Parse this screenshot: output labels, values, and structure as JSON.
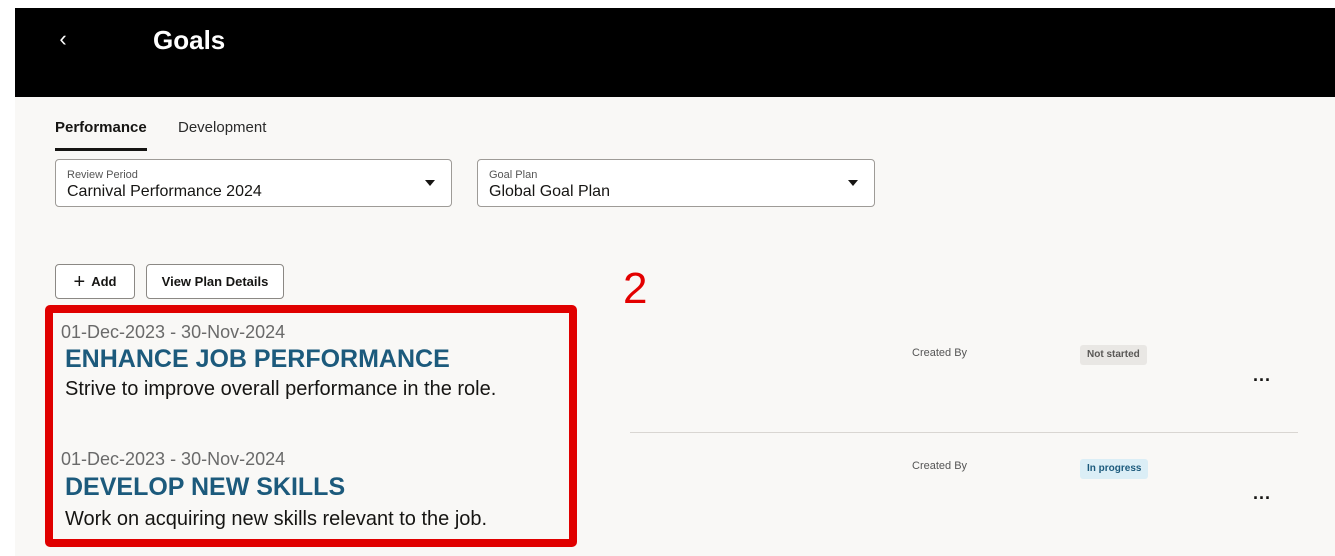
{
  "header": {
    "back_glyph": "‹",
    "title": "Goals"
  },
  "tabs": [
    {
      "label": "Performance",
      "active": true
    },
    {
      "label": "Development",
      "active": false
    }
  ],
  "filters": {
    "review_period": {
      "label": "Review Period",
      "value": "Carnival Performance 2024"
    },
    "goal_plan": {
      "label": "Goal Plan",
      "value": "Global Goal Plan"
    }
  },
  "actions": {
    "add_icon": "+",
    "add_label": "Add",
    "view_plan_details_label": "View Plan Details"
  },
  "annotation": {
    "step_number": "2",
    "color": "#e00000"
  },
  "goals": [
    {
      "dates": "01-Dec-2023 - 30-Nov-2024",
      "title": "ENHANCE JOB PERFORMANCE",
      "description": "Strive to improve overall performance in the role.",
      "created_by_label": "Created By",
      "status": "Not started",
      "more_glyph": "..."
    },
    {
      "dates": "01-Dec-2023 - 30-Nov-2024",
      "title": "DEVELOP NEW SKILLS",
      "description": "Work on acquiring new skills relevant to the job.",
      "created_by_label": "Created By",
      "status": "In progress",
      "more_glyph": "..."
    }
  ],
  "colors": {
    "header_bg": "#000000",
    "goal_title": "#1c5a7c",
    "annotation_red": "#e00000"
  }
}
